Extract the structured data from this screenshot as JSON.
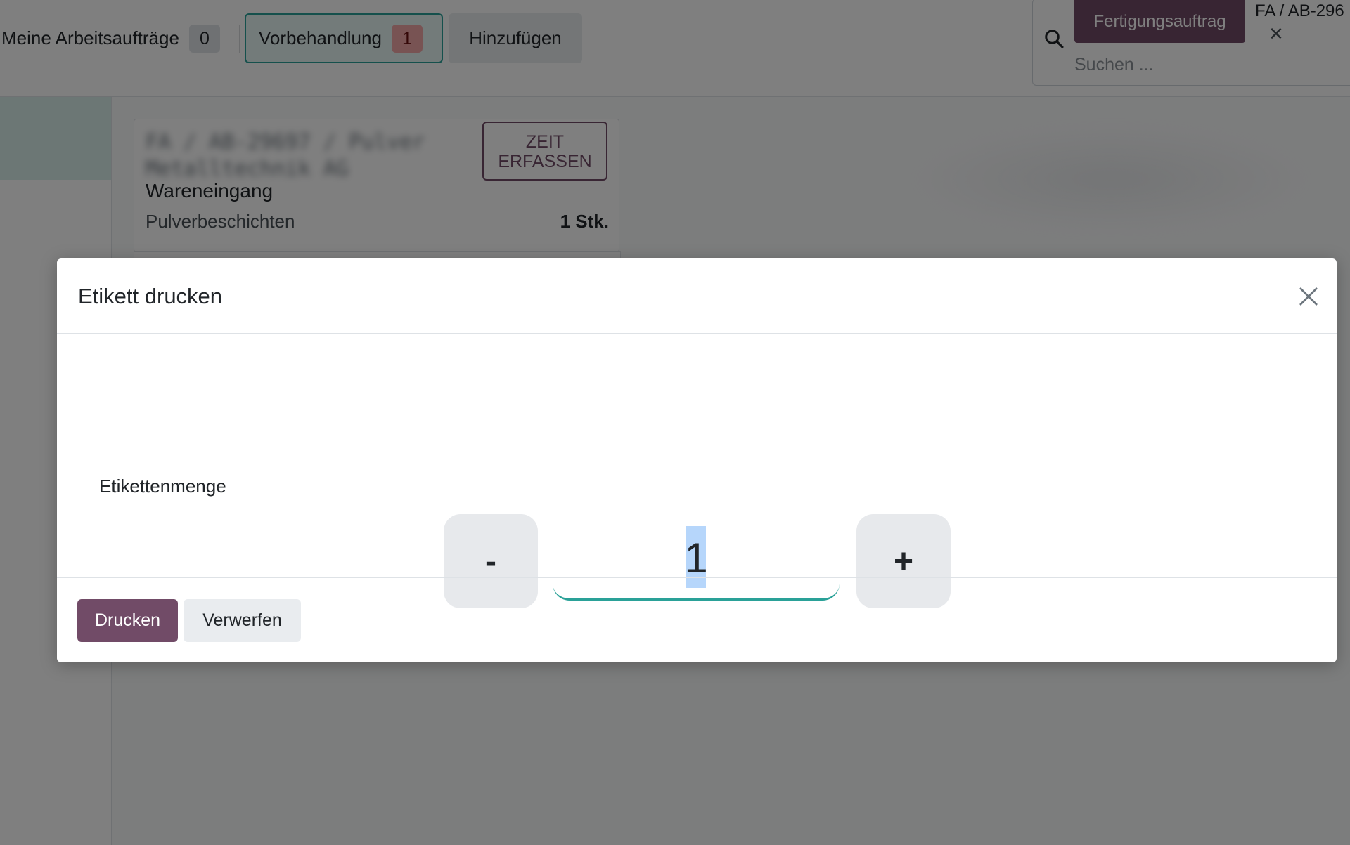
{
  "topbar": {
    "tabs": [
      {
        "label": "Meine Arbeitsaufträge",
        "count": "0"
      },
      {
        "label": "Vorbehandlung",
        "count": "1"
      },
      {
        "label": "Hinzufügen"
      }
    ],
    "search": {
      "facet_label": "Fertigungsauftrag",
      "facet_value": "FA / AB-296",
      "placeholder": "Suchen ..."
    }
  },
  "card": {
    "blurred_title": "FA / AB-29697 / Pulver Metalltechnik AG",
    "time_button": "ZEIT ERFASSEN",
    "subtitle": "Wareneingang",
    "operation": "Pulverbeschichten",
    "quantity": "1 Stk."
  },
  "modal": {
    "title": "Etikett drucken",
    "field_label": "Etikettenmenge",
    "minus_label": "-",
    "plus_label": "+",
    "quantity_value": "1",
    "primary_button": "Drucken",
    "secondary_button": "Verwerfen"
  },
  "colors": {
    "brand": "#714b67",
    "accent": "#2aa198",
    "badge_alert": "#f0a7a7",
    "selection": "#b6d6fb"
  },
  "icons": [
    "search-icon",
    "close-icon",
    "facet-remove-icon"
  ]
}
